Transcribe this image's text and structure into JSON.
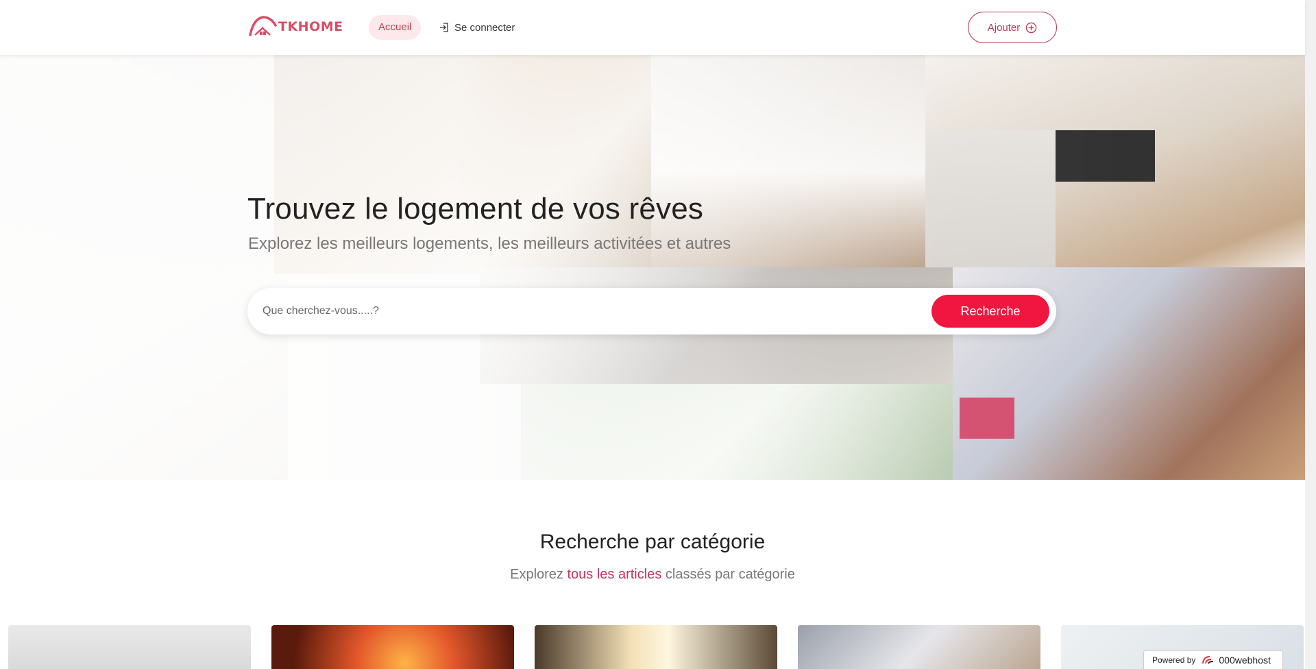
{
  "header": {
    "logo_text": "TKHOME",
    "nav": {
      "home_label": "Accueil",
      "login_label": "Se connecter"
    },
    "add_label": "Ajouter"
  },
  "hero": {
    "title": "Trouvez le logement de vos rêves",
    "subtitle": "Explorez les meilleurs logements, les meilleurs activitées et autres",
    "search": {
      "placeholder": "Que cherchez-vous.....?",
      "value": "",
      "button_label": "Recherche"
    }
  },
  "categories": {
    "title": "Recherche par catégorie",
    "subtitle_before": "Explorez ",
    "subtitle_link": "tous les articles",
    "subtitle_after": " classés par catégorie",
    "cards": [
      {
        "icon": "category-photo-icon"
      },
      {
        "icon": "category-photo-icon"
      },
      {
        "icon": "category-photo-icon"
      },
      {
        "icon": "category-photo-icon"
      },
      {
        "icon": "category-photo-icon"
      }
    ]
  },
  "badge": {
    "powered_label": "Powered by",
    "brand": "000webhost"
  },
  "colors": {
    "accent": "#f0163f",
    "brand": "#d94d63",
    "link": "#c3345a"
  }
}
